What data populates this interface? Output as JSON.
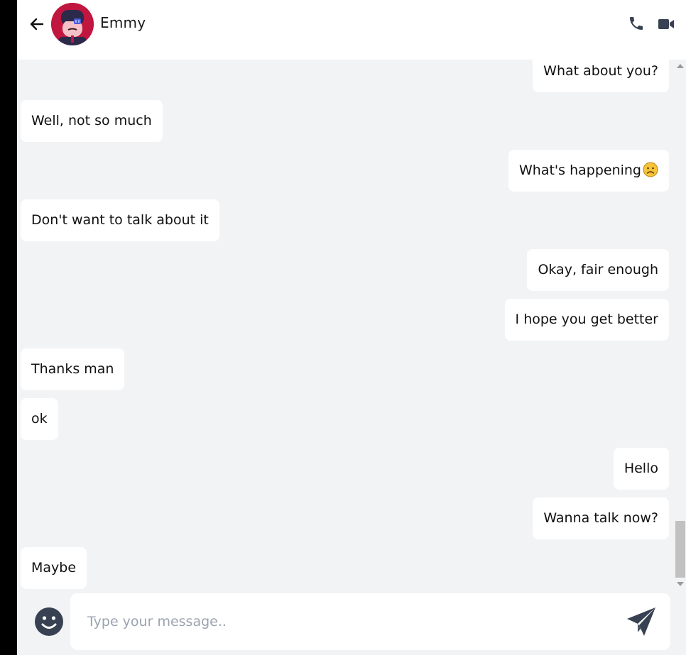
{
  "header": {
    "contact_name": "Emmy",
    "back_icon": "arrow-left-icon",
    "call_icon": "phone-icon",
    "video_icon": "video-camera-icon"
  },
  "messages": [
    {
      "direction": "out",
      "text": "What about you?"
    },
    {
      "direction": "in",
      "text": "Well, not so much"
    },
    {
      "direction": "out",
      "text": "What's happening",
      "emoji": "slightly-frowning-face"
    },
    {
      "direction": "in",
      "text": "Don't want to talk about it"
    },
    {
      "direction": "out",
      "text": "Okay, fair enough"
    },
    {
      "direction": "out",
      "text": "I hope you get better"
    },
    {
      "direction": "in",
      "text": "Thanks man"
    },
    {
      "direction": "in",
      "text": "ok"
    },
    {
      "direction": "out",
      "text": "Hello"
    },
    {
      "direction": "out",
      "text": "Wanna talk now?"
    },
    {
      "direction": "in",
      "text": "Maybe"
    }
  ],
  "composer": {
    "placeholder": "Type your message..",
    "value": "",
    "emoji_icon": "smiley-icon",
    "send_icon": "paper-plane-icon"
  },
  "colors": {
    "background": "#f2f3f5",
    "bubble": "#ffffff",
    "icon": "#374151",
    "avatar_bg": "#c0163f"
  }
}
